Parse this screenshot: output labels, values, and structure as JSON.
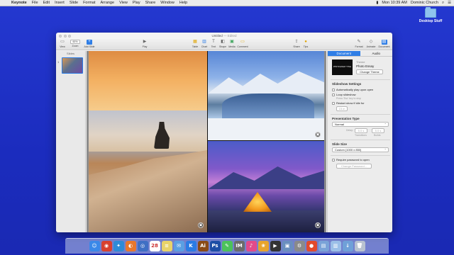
{
  "menubar": {
    "apple": "",
    "app_name": "Keynote",
    "menus": [
      "File",
      "Edit",
      "Insert",
      "Slide",
      "Format",
      "Arrange",
      "View",
      "Play",
      "Share",
      "Window",
      "Help"
    ],
    "status": {
      "battery": "▮",
      "time": "Mon 10:39 AM",
      "user": "Dominic Church"
    }
  },
  "desktop": {
    "folder_label": "Desktop Stuff"
  },
  "window": {
    "title": "Untitled",
    "subtitle": "— Edited",
    "toolbar": {
      "view": "View",
      "zoom_value": "60%",
      "zoom_label": "Zoom",
      "add_slide": "Add Slide",
      "play": "Play",
      "table": "Table",
      "chart": "Chart",
      "text": "Text",
      "shape": "Shape",
      "media": "Media",
      "comment": "Comment",
      "share": "Share",
      "tips": "Tips",
      "format": "Format",
      "animate": "Animate",
      "document": "Document"
    },
    "sidebar": {
      "header": "Slides",
      "slide_number": "1"
    }
  },
  "inspector": {
    "tabs": [
      "Document",
      "Audio"
    ],
    "theme_label": "Theme",
    "theme_name": "Photo Essay",
    "theme_thumb_text": "PHOTO ESSAY TITLE",
    "change_theme": "Change Theme",
    "slideshow_header": "Slideshow Settings",
    "autoplay": "Automatically play upon open",
    "loop": "Loop slideshow",
    "loop_note": "Press 'Esc' key to stop",
    "restart": "Restart show if idle for",
    "restart_value": "15 m",
    "presentation_header": "Presentation Type",
    "presentation_value": "Normal",
    "delay_label": "Delay:",
    "delay_value1": "5.0 s",
    "delay_value2": "5.0 s",
    "transitions": "Transitions",
    "builds": "Builds",
    "slide_size_header": "Slide Size",
    "slide_size_value": "Custom (1000 x 850)",
    "password": "Require password to open",
    "change_password": "Change Password..."
  },
  "dock": {
    "apps": [
      {
        "label": "Finder",
        "glyph": "☺",
        "color": "#3a88e8"
      },
      {
        "label": "Chrome",
        "glyph": "◉",
        "color": "#d8412f"
      },
      {
        "label": "Safari",
        "glyph": "✦",
        "color": "#2d8bd8"
      },
      {
        "label": "Firefox",
        "glyph": "◐",
        "color": "#e8772d"
      },
      {
        "label": "Dashboard",
        "glyph": "◎",
        "color": "#3f6fc4"
      },
      {
        "label": "Calendar",
        "glyph": "28",
        "color": "#ffffff"
      },
      {
        "label": "Notes",
        "glyph": "≡",
        "color": "#e8d36a"
      },
      {
        "label": "Mail",
        "glyph": "✉",
        "color": "#5a9fe3"
      },
      {
        "label": "Keynote",
        "glyph": "K",
        "color": "#2b7be4"
      },
      {
        "label": "Illustrator",
        "glyph": "Ai",
        "color": "#8a4a16"
      },
      {
        "label": "Photoshop",
        "glyph": "Ps",
        "color": "#1d4ea6"
      },
      {
        "label": "Messages",
        "glyph": "✎",
        "color": "#4cc25b"
      },
      {
        "label": "iMovie",
        "glyph": "IM",
        "color": "#6b6b6b"
      },
      {
        "label": "Music",
        "glyph": "♪",
        "color": "#e24a8a"
      },
      {
        "label": "Photos",
        "glyph": "❀",
        "color": "#e8a42d"
      },
      {
        "label": "Final Cut",
        "glyph": "▶",
        "color": "#333333"
      },
      {
        "label": "Preview",
        "glyph": "▣",
        "color": "#6a8fbf"
      },
      {
        "label": "Settings",
        "glyph": "⚙",
        "color": "#8a8a8a"
      },
      {
        "label": "Chat",
        "glyph": "●",
        "color": "#e24a2d"
      },
      {
        "label": "Files",
        "glyph": "▤",
        "color": "#7aa3d8"
      },
      {
        "label": "Folder",
        "glyph": "▥",
        "color": "#9bbfe8"
      },
      {
        "label": "Downloads",
        "glyph": "↓",
        "color": "#6fa0d8"
      },
      {
        "label": "Trash",
        "glyph": "🗑",
        "color": "#b8c2d0"
      }
    ]
  }
}
